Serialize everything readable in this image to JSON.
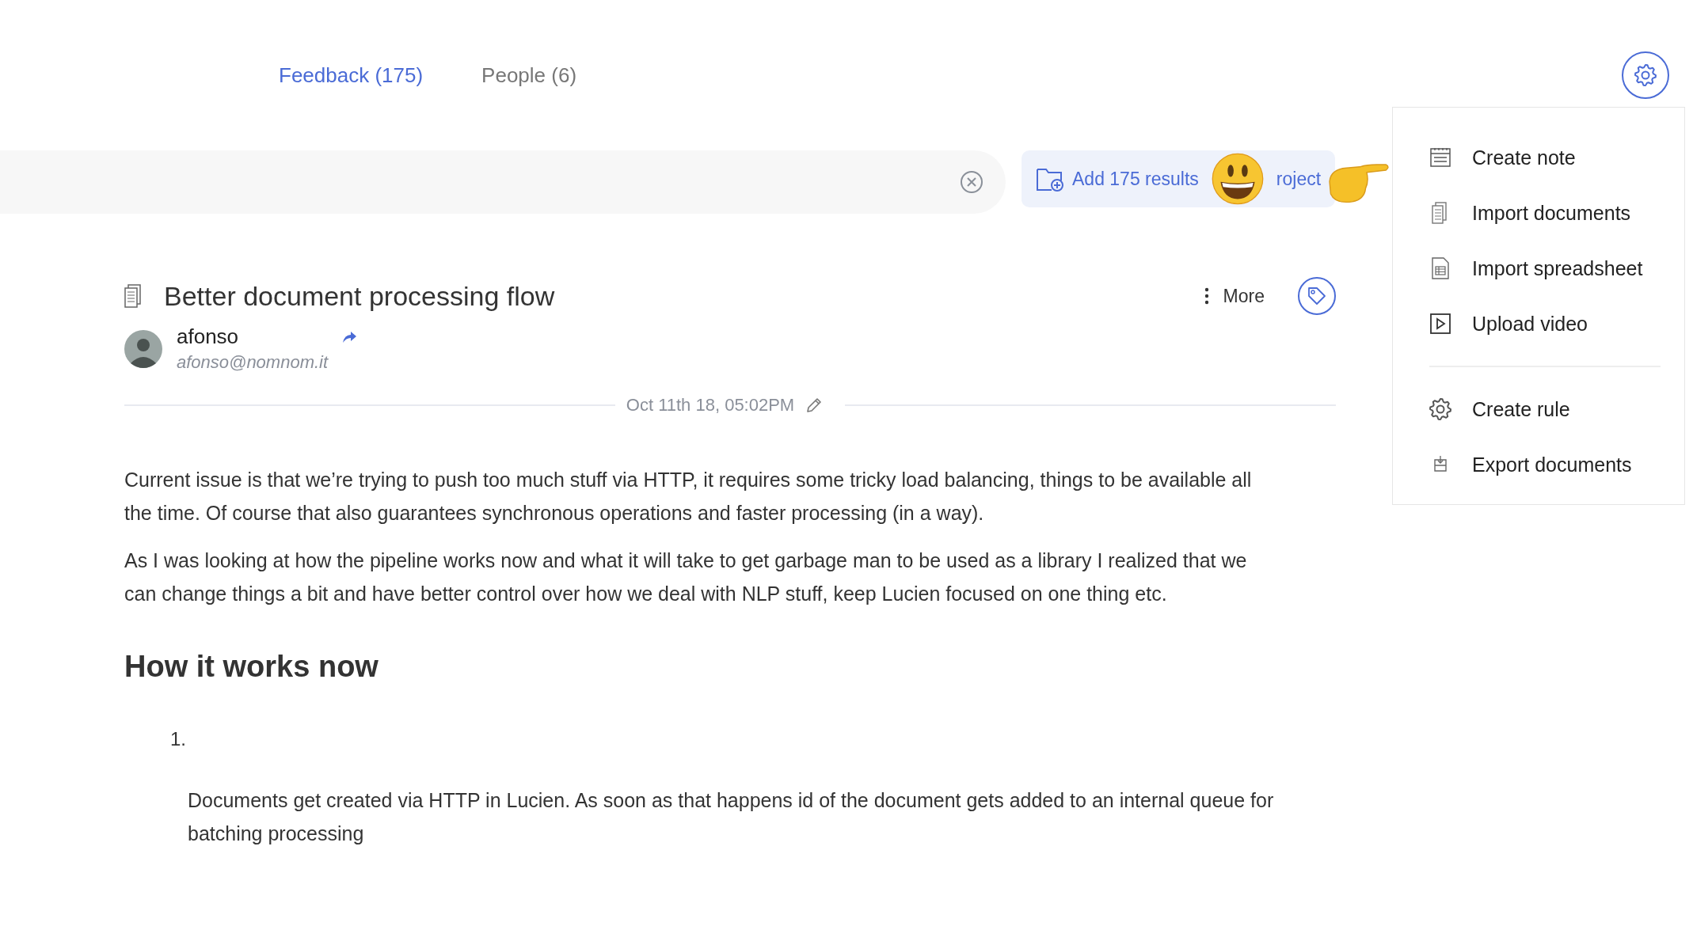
{
  "tabs": [
    {
      "label": "Feedback (175)",
      "selected": true
    },
    {
      "label": "People (6)",
      "selected": false
    }
  ],
  "add_button": {
    "label_parts": [
      "Add 175 results",
      "roject"
    ]
  },
  "document": {
    "title": "Better document processing flow",
    "more_label": "More",
    "author": {
      "name": "afonso",
      "email": "afonso@nomnom.it"
    },
    "date": "Oct 11th 18, 05:02PM",
    "paragraphs": [
      "Current issue is that we’re trying to push too much stuff via HTTP, it requires some tricky load balancing, things to be available all the time. Of course that also guarantees synchronous operations and faster processing (in a way).",
      "As I was looking at how the pipeline works now and what it will take to get garbage man to be used as a library I realized that we can change things a bit and have better control over how we deal with NLP stuff, keep Lucien focused on one thing etc."
    ],
    "heading": "How it works now",
    "list": [
      {
        "number": "1.",
        "text": "Documents get created via HTTP in Lucien. As soon as that happens id of the document gets added to an internal queue for batching processing"
      }
    ]
  },
  "menu": {
    "groups": [
      [
        {
          "label": "Create note",
          "kind": "note"
        },
        {
          "label": "Import documents",
          "kind": "documents"
        },
        {
          "label": "Import spreadsheet",
          "kind": "spreadsheet"
        },
        {
          "label": "Upload video",
          "kind": "video"
        }
      ],
      [
        {
          "label": "Create rule",
          "kind": "rule"
        },
        {
          "label": "Export documents",
          "kind": "export"
        }
      ]
    ]
  }
}
